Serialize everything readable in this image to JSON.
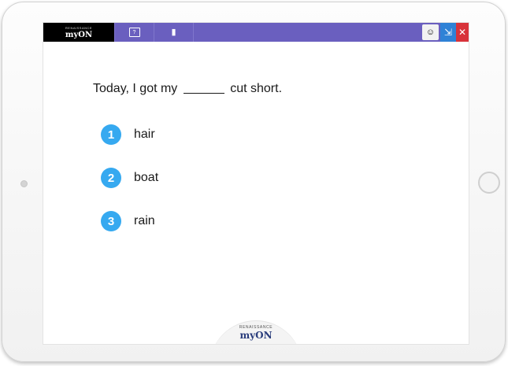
{
  "toolbar": {
    "brand_small": "RENAISSANCE",
    "brand_big": "myON",
    "icons": [
      "reader-question-icon",
      "book-icon",
      "avatar-icon",
      "exit-icon",
      "close-icon"
    ]
  },
  "question": {
    "before": "Today, I got my",
    "after": "cut short."
  },
  "options": [
    {
      "number": "1",
      "label": "hair"
    },
    {
      "number": "2",
      "label": "boat"
    },
    {
      "number": "3",
      "label": "rain"
    }
  ],
  "footer": {
    "brand_small": "RENAISSANCE",
    "brand_big": "myON"
  },
  "colors": {
    "toolbar": "#6a5fbf",
    "option_badge": "#36a9f0",
    "exit": "#2f82d6",
    "close": "#d8333a"
  }
}
